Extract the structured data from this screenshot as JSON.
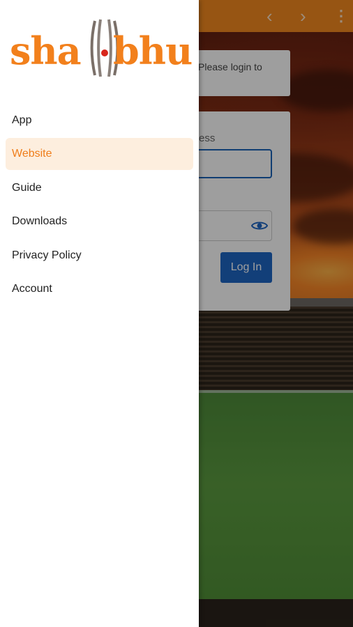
{
  "app_bar": {
    "back_icon": "chevron-left-icon",
    "forward_icon": "chevron-right-icon",
    "more_icon": "more-vertical-icon",
    "color": "#f48a1f"
  },
  "login": {
    "message_partial": "Please login to",
    "email_label_partial": "ress",
    "password_icon": "eye-icon",
    "login_button": "Log In",
    "accent": "#1e66c4"
  },
  "drawer": {
    "logo_text": "shambhu",
    "logo_left": "sha",
    "logo_right": "bhu",
    "items": [
      {
        "label": "App"
      },
      {
        "label": "Website",
        "active": true
      },
      {
        "label": "Guide"
      },
      {
        "label": "Downloads"
      },
      {
        "label": "Privacy Policy"
      },
      {
        "label": "Account"
      }
    ],
    "active_color": "#ef7d1a",
    "active_bg": "#fdeede"
  }
}
